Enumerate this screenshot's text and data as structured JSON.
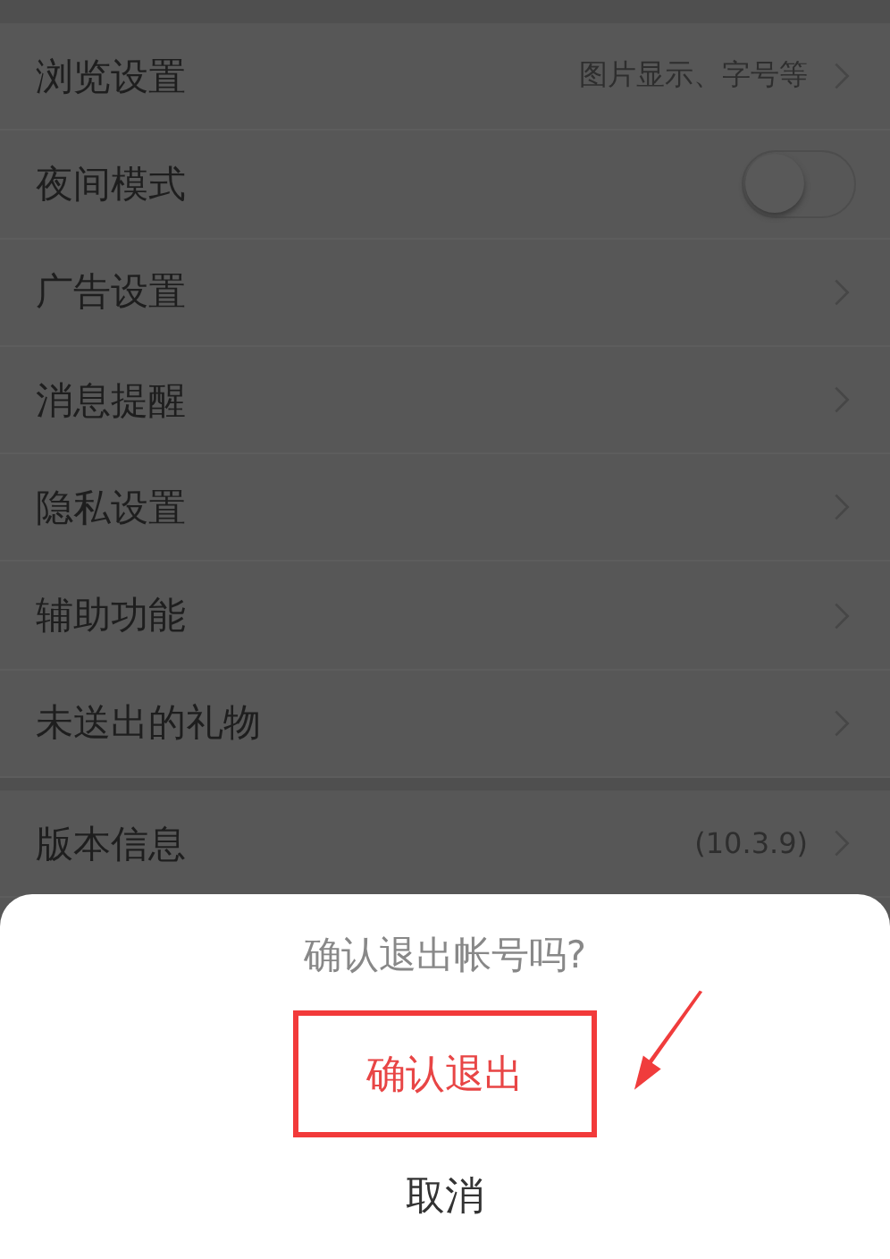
{
  "settings": [
    {
      "kind": "link",
      "label": "浏览设置",
      "detail": "图片显示、字号等"
    },
    {
      "kind": "toggle",
      "label": "夜间模式",
      "on": false
    },
    {
      "kind": "link",
      "label": "广告设置"
    },
    {
      "kind": "link",
      "label": "消息提醒"
    },
    {
      "kind": "link",
      "label": "隐私设置"
    },
    {
      "kind": "link",
      "label": "辅助功能"
    },
    {
      "kind": "link",
      "label": "未送出的礼物"
    }
  ],
  "about": [
    {
      "kind": "link",
      "label": "版本信息",
      "detail": "(10.3.9)"
    }
  ],
  "action_sheet": {
    "title": "确认退出帐号吗?",
    "actions": [
      {
        "label": "确认退出",
        "kind": "destructive",
        "highlighted": true
      },
      {
        "label": "取消",
        "kind": "cancel",
        "highlighted": false
      }
    ]
  }
}
